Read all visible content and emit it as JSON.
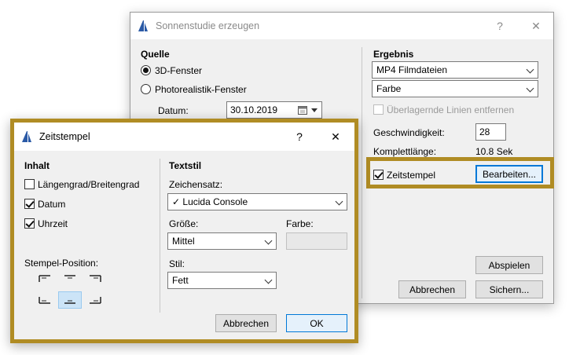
{
  "back_window": {
    "title": "Sonnenstudie erzeugen",
    "help_label": "?",
    "close_label": "✕",
    "source": {
      "title": "Quelle",
      "option_3d": "3D-Fenster",
      "option_photo": "Photorealistik-Fenster",
      "date_label": "Datum:",
      "date_value": "30.10.2019"
    },
    "result": {
      "title": "Ergebnis",
      "format_value": "MP4 Filmdateien",
      "color_value": "Farbe",
      "overlay_label": "Überlagernde Linien entfernen",
      "speed_label": "Geschwindigkeit:",
      "speed_value": "28",
      "length_label": "Komplettlänge:",
      "length_value": "10.8 Sek",
      "timestamp_label": "Zeitstempel",
      "edit_button": "Bearbeiten...",
      "play_button": "Abspielen"
    },
    "cancel_button": "Abbrechen",
    "save_button": "Sichern..."
  },
  "front_window": {
    "title": "Zeitstempel",
    "help_label": "?",
    "close_label": "✕",
    "content": {
      "title": "Inhalt",
      "longlat_label": "Längengrad/Breitengrad",
      "date_label": "Datum",
      "time_label": "Uhrzeit",
      "position_label": "Stempel-Position:"
    },
    "text_style": {
      "title": "Textstil",
      "font_label": "Zeichensatz:",
      "font_value": "✓ Lucida Console",
      "size_label": "Größe:",
      "size_value": "Mittel",
      "color_label": "Farbe:",
      "style_label": "Stil:",
      "style_value": "Fett"
    },
    "cancel_button": "Abbrechen",
    "ok_button": "OK"
  },
  "colors": {
    "highlight": "#b08c24",
    "accent": "#0078d7"
  }
}
